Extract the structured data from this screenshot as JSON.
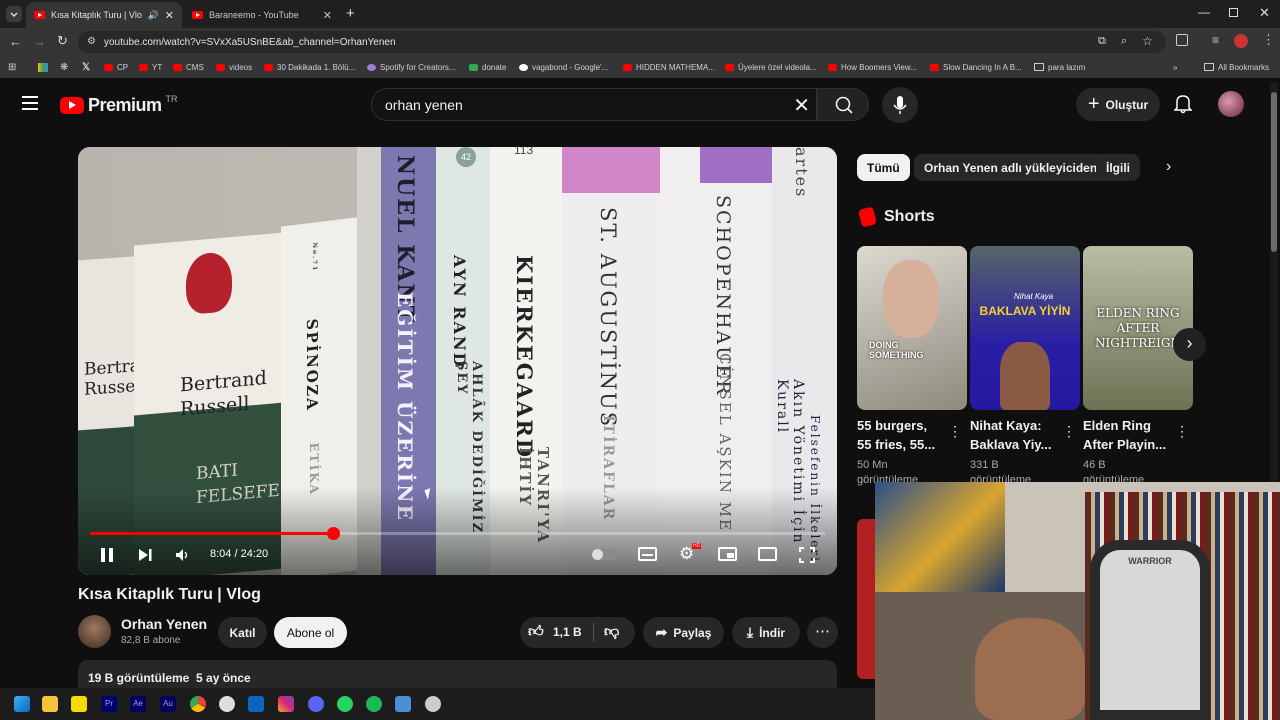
{
  "browser": {
    "tabs": [
      {
        "title": "Kısa Kitaplık Turu | Vlog - Yo",
        "active": true
      },
      {
        "title": "Baraneemo - YouTube",
        "active": false
      }
    ],
    "url": "youtube.com/watch?v=SVxXa5USnBE&ab_channel=OrhanYenen",
    "bookmarks": [
      "CP",
      "YT",
      "CMS",
      "videos",
      "30 Dakikada 1. Bölü...",
      "Spotify for Creators...",
      "donate",
      "vagabond - Google'...",
      "HIDDEN MATHEMA...",
      "Üyelere özel videola...",
      "How Boomers View...",
      "Slow Dancing In A B...",
      "para lazım",
      "All Bookmarks"
    ]
  },
  "masthead": {
    "logo": "Premium",
    "region": "TR",
    "search_value": "orhan yenen",
    "create_label": "Oluştur"
  },
  "video": {
    "time": "8:04 / 24:20",
    "progress": 0.33,
    "hd_badge": "HD",
    "books": [
      "Bertrand Russell",
      "Bertrand Russell",
      "BATI FELSEFESİ",
      "No.71",
      "SPİNOZA",
      "ETİKA",
      "NUEL KANT",
      "EĞİTİM ÜZERİNE",
      "42",
      "AYN RAND",
      "AHLÂK DEDİĞİMİZ ŞEY",
      "113",
      "KIERKEGAARD",
      "TANRI'YA İHTİY",
      "ST. AUGUSTİNUS",
      "İTİRAFLAR",
      "SCHOPENHAUER",
      "CİNSEL AŞKIN ME",
      "artes",
      "Akın Yönetimi İçin Kurall",
      "Felsefenin İlkeleri"
    ]
  },
  "meta": {
    "title": "Kısa Kitaplık Turu | Vlog",
    "channel": "Orhan Yenen",
    "subscribers": "82,8 B abone",
    "join": "Katıl",
    "subscribe": "Abone ol",
    "likes": "1,1 B",
    "share": "Paylaş",
    "download": "İndir",
    "views_date": "19 B görüntüleme  5 ay önce"
  },
  "chips": [
    "Tümü",
    "Orhan Yenen adlı yükleyiciden",
    "İlgili"
  ],
  "shorts": {
    "heading": "Shorts",
    "items": [
      {
        "title1": "55 burgers,",
        "title2": "55 fries, 55...",
        "views": "50 Mn",
        "views2": "görüntüleme",
        "overlay": "DOING SOMETHING"
      },
      {
        "title1": "Nihat Kaya:",
        "title2": "Baklava Yiy...",
        "views": "331 B",
        "views2": "görüntüleme",
        "overlay": "BAKLAVA YİYİN",
        "overlay_top": "Nihat Kaya"
      },
      {
        "title1": "Elden Ring",
        "title2": "After Playin...",
        "views": "46 B",
        "views2": "görüntüleme",
        "overlay": "ELDEN RING AFTER NIGHTREIGN"
      }
    ]
  },
  "webcam": {
    "chair_text": "WARRIOR"
  },
  "colors": {
    "accent": "#ff0000",
    "bg": "#0f0f0f",
    "chip_active": "#f1f1f1"
  }
}
